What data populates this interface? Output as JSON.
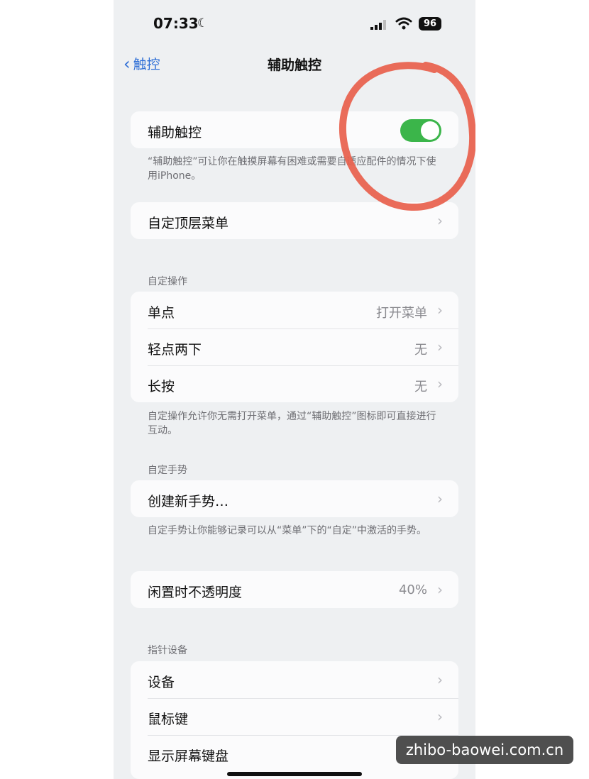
{
  "status_bar": {
    "time": "07:33",
    "battery": "96"
  },
  "nav": {
    "back_label": "触控",
    "title": "辅助触控"
  },
  "assistive_touch": {
    "label": "辅助触控",
    "enabled": true,
    "footer": "“辅助触控”可让你在触摸屏幕有困难或需要自适应配件的情况下使用iPhone。"
  },
  "customize_top_menu": {
    "label": "自定顶层菜单"
  },
  "custom_actions": {
    "header": "自定操作",
    "rows": [
      {
        "label": "单点",
        "value": "打开菜单"
      },
      {
        "label": "轻点两下",
        "value": "无"
      },
      {
        "label": "长按",
        "value": "无"
      }
    ],
    "footer": "自定操作允许你无需打开菜单，通过“辅助触控”图标即可直接进行互动。"
  },
  "custom_gestures": {
    "header": "自定手势",
    "create_label": "创建新手势…",
    "footer": "自定手势让你能够记录可以从“菜单”下的“自定”中激活的手势。"
  },
  "idle_opacity": {
    "label": "闲置时不透明度",
    "value": "40%"
  },
  "pointer_devices": {
    "header": "指针设备",
    "rows": [
      {
        "label": "设备"
      },
      {
        "label": "鼠标键"
      },
      {
        "label": "显示屏幕键盘"
      }
    ]
  },
  "watermark": "zhibo-baowei.com.cn",
  "colors": {
    "accent": "#2f6fd6",
    "toggle_on": "#3bb54a",
    "annotation": "#e8604c"
  }
}
